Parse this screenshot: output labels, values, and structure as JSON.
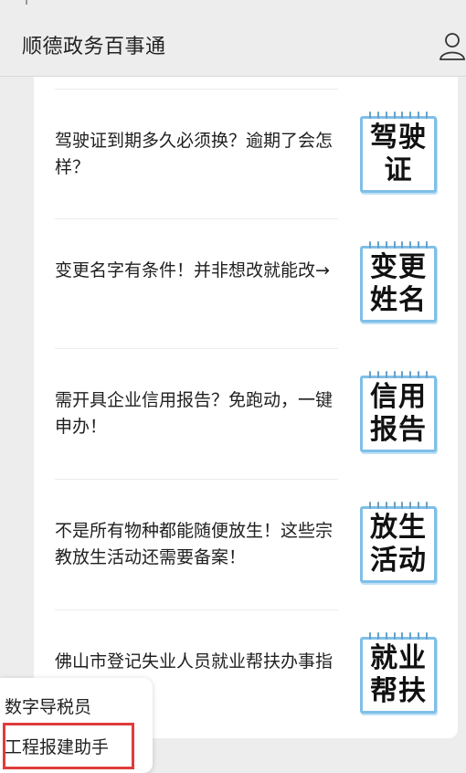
{
  "header": {
    "title": "顺德政务百事通",
    "user_icon": "user-icon"
  },
  "articles": [
    {
      "title": "驾驶证到期多久必须换？逾期了会怎样？",
      "badge": [
        "驾驶",
        "证"
      ]
    },
    {
      "title": "变更名字有条件！并非想改就能改→",
      "badge": [
        "变更",
        "姓名"
      ]
    },
    {
      "title": "需开具企业信用报告？免跑动，一键申办！",
      "badge": [
        "信用",
        "报告"
      ]
    },
    {
      "title": "不是所有物种都能随便放生！这些宗教放生活动还需要备案！",
      "badge": [
        "放生",
        "活动"
      ]
    },
    {
      "title": "佛山市登记失业人员就业帮扶办事指南",
      "badge": [
        "就业",
        "帮扶"
      ]
    }
  ],
  "popup_menu": {
    "items": [
      "数字导税员",
      "工程报建助手"
    ],
    "highlight_color": "#e03c3c"
  }
}
